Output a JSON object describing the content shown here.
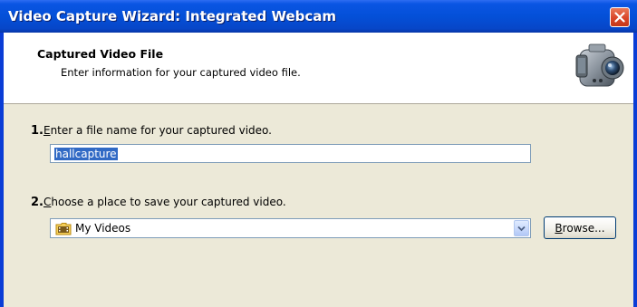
{
  "window": {
    "title": "Video Capture Wizard: Integrated Webcam"
  },
  "header": {
    "title": "Captured Video File",
    "subtitle": "Enter information for your captured video file."
  },
  "steps": [
    {
      "number": "1.",
      "accel": "E",
      "label_rest": "nter a file name for your captured video."
    },
    {
      "number": "2.",
      "accel": "C",
      "label_rest": "hoose a place to save your captured video."
    }
  ],
  "filename": {
    "value": "hallcapture"
  },
  "save_location": {
    "selected": "My Videos"
  },
  "browse": {
    "accel": "B",
    "label_rest": "rowse..."
  },
  "colors": {
    "title_bar": "#0450d8",
    "close_button": "#d9462a",
    "dialog_face": "#ece9d8",
    "selection": "#316ac5"
  },
  "icons": [
    "close-icon",
    "camcorder-icon",
    "folder-icon",
    "chevron-down-icon"
  ]
}
